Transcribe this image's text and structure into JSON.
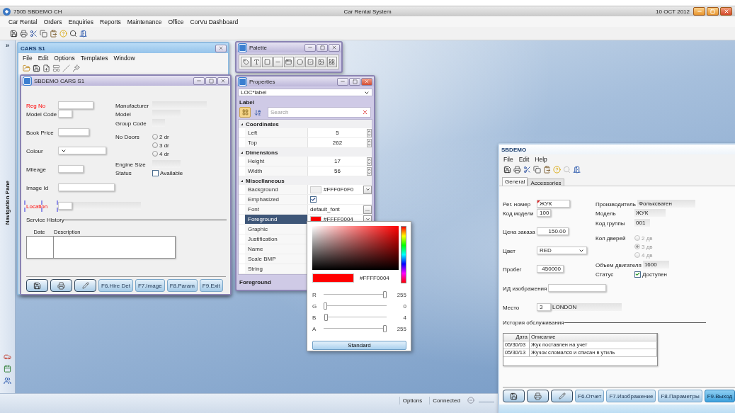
{
  "app": {
    "title": "7505 SBDEMO CH",
    "caption": "Car Rental System",
    "date": "10 OCT 2012"
  },
  "menu": [
    "Car Rental",
    "Orders",
    "Enquiries",
    "Reports",
    "Maintenance",
    "Office",
    "CorVu Dashboard"
  ],
  "nav_pane": {
    "toggle": "»",
    "label": "Navigation Pane"
  },
  "cars_window": {
    "title": "CARS S1",
    "menu": [
      "File",
      "Edit",
      "Options",
      "Templates",
      "Window"
    ]
  },
  "design_form": {
    "title": "SBDEMO CARS S1",
    "left_fields": [
      {
        "kind": "text",
        "label": "Reg No",
        "required": true,
        "selected": false
      },
      {
        "kind": "text",
        "label": "Model Code",
        "required": false,
        "selected": false
      },
      {
        "kind": "text",
        "label": "Book Price",
        "required": false,
        "selected": false
      },
      {
        "kind": "dropdown",
        "label": "Colour",
        "required": false,
        "selected": false
      },
      {
        "kind": "text",
        "label": "Mileage",
        "required": false,
        "selected": false
      },
      {
        "kind": "text",
        "label": "Image Id",
        "required": false,
        "selected": false
      },
      {
        "kind": "lookup",
        "label": "Location",
        "required": true,
        "selected": true
      }
    ],
    "right_fields": [
      {
        "kind": "display",
        "label": "Manufacturer"
      },
      {
        "kind": "display",
        "label": "Model"
      },
      {
        "kind": "display",
        "label": "Group Code"
      },
      {
        "kind": "radio",
        "label": "No Doors",
        "disabled": false,
        "options": [
          {
            "label": "2 dr",
            "selected": false
          },
          {
            "label": "3 dr",
            "selected": false
          },
          {
            "label": "4 dr",
            "selected": false
          }
        ]
      },
      {
        "kind": "display",
        "label": "Engine Size"
      },
      {
        "kind": "checkbox",
        "label": "Status",
        "option": "Available",
        "checked": false
      }
    ],
    "section": "Service History",
    "table": {
      "columns": [
        "Date",
        "Description"
      ]
    },
    "buttons": [
      {
        "label": "F6.Hire Det",
        "highlighted": false
      },
      {
        "label": "F7.Image",
        "highlighted": false
      },
      {
        "label": "F8.Param",
        "highlighted": false
      },
      {
        "label": "F9.Exit",
        "highlighted": false
      }
    ]
  },
  "palette": {
    "title": "Palette"
  },
  "properties": {
    "title": "Properties",
    "selector": "LOC*label",
    "section": "Label",
    "search_placeholder": "Search",
    "groups": [
      {
        "name": "Coordinates",
        "expanded": true,
        "rows": [
          {
            "name": "Left",
            "kind": "spin",
            "value": "5",
            "selected": false
          },
          {
            "name": "Top",
            "kind": "spin",
            "value": "262",
            "selected": false
          }
        ]
      },
      {
        "name": "Dimensions",
        "expanded": true,
        "rows": [
          {
            "name": "Height",
            "kind": "spin",
            "value": "17",
            "selected": false
          },
          {
            "name": "Width",
            "kind": "spin",
            "value": "56",
            "selected": false
          }
        ]
      },
      {
        "name": "Miscellaneous",
        "expanded": true,
        "rows": [
          {
            "name": "Background",
            "kind": "color",
            "value": "#FFF0F0F0",
            "color": "#f0f0f0",
            "selected": false
          },
          {
            "name": "Emphasized",
            "kind": "check",
            "checked": true,
            "selected": false
          },
          {
            "name": "Font",
            "kind": "browse",
            "value": "default_font",
            "button": "...",
            "selected": false
          },
          {
            "name": "Foreground",
            "kind": "color",
            "value": "#FFFF0004",
            "color": "#ff0000",
            "selected": true
          },
          {
            "name": "Graphic",
            "kind": "text",
            "selected": false
          },
          {
            "name": "Justification",
            "kind": "text",
            "selected": false
          },
          {
            "name": "Name",
            "kind": "text",
            "selected": false
          },
          {
            "name": "Scale BMP",
            "kind": "text",
            "selected": false
          },
          {
            "name": "String",
            "kind": "text",
            "selected": false
          }
        ]
      }
    ],
    "description": "Foreground"
  },
  "color_picker": {
    "color": "#ff0000",
    "hex": "#FFFF0004",
    "channels": [
      {
        "name": "R",
        "level": 1,
        "reading": "255"
      },
      {
        "name": "G",
        "level": 0,
        "reading": "0"
      },
      {
        "name": "B",
        "level": 0.016,
        "reading": "4"
      },
      {
        "name": "A",
        "level": 1,
        "reading": "255"
      }
    ],
    "button": "Standard"
  },
  "record_window": {
    "title": "SBDEMO",
    "menu": [
      "File",
      "Edit",
      "Help"
    ],
    "tabs": [
      {
        "label": "General",
        "selected": true
      },
      {
        "label": "Accessories",
        "selected": false
      }
    ],
    "form": {
      "left_fields": [
        {
          "kind": "text",
          "label": "Рег. номер",
          "value": "ЖУК",
          "required": true
        },
        {
          "kind": "text",
          "label": "Код модели",
          "value": "100",
          "required": false
        },
        {
          "kind": "text",
          "label": "Цена заказа",
          "value": "150.00",
          "required": false
        },
        {
          "kind": "dropdown",
          "label": "Цвет",
          "value": "RED",
          "required": false
        },
        {
          "kind": "text",
          "label": "Пробег",
          "value": "450000",
          "required": false
        },
        {
          "kind": "text",
          "label": "ИД изображения",
          "required": false
        },
        {
          "kind": "lookup",
          "label": "Место",
          "value": "3",
          "description": "LONDON",
          "required": false
        }
      ],
      "right_fields": [
        {
          "kind": "display",
          "label": "Производитель",
          "value": "Фольксваген"
        },
        {
          "kind": "display",
          "label": "Модель",
          "value": "ЖУК"
        },
        {
          "kind": "display",
          "label": "Код группы",
          "value": "001"
        },
        {
          "kind": "radio",
          "label": "Кол дверей",
          "disabled": true,
          "options": [
            {
              "label": "2 дв",
              "selected": false
            },
            {
              "label": "3 дв",
              "selected": true
            },
            {
              "label": "4 дв",
              "selected": false
            }
          ]
        },
        {
          "kind": "display",
          "label": "Объем двигателя",
          "value": "1600"
        },
        {
          "kind": "checkbox",
          "label": "Статус",
          "option": "Доступен",
          "checked": true
        }
      ],
      "section": "История обслуживания",
      "table": {
        "columns": [
          "Дата",
          "Описание"
        ],
        "rows": [
          [
            "05/30/03",
            "Жук поставлен на учет"
          ],
          [
            "05/30/13",
            "Жучок сломался и списан в утиль"
          ]
        ]
      },
      "buttons": [
        {
          "label": "F6.Отчет",
          "highlighted": false
        },
        {
          "label": "F7.Изображение",
          "highlighted": false
        },
        {
          "label": "F8.Параметры",
          "highlighted": false
        },
        {
          "label": "F9.Выход",
          "highlighted": true
        }
      ]
    }
  },
  "status_bar": [
    "Options",
    "Connected"
  ]
}
